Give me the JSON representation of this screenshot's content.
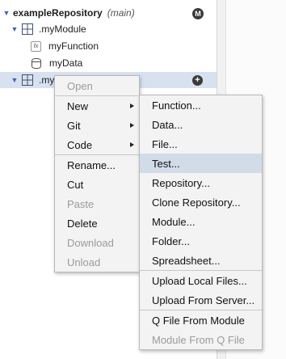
{
  "tree": {
    "repo": {
      "name": "exampleRepository",
      "branch": "(main)",
      "badge": "M"
    },
    "module": {
      "name": ".myModule"
    },
    "function_item": {
      "name": "myFunction",
      "icon": "function-icon"
    },
    "data_item": {
      "name": "myData",
      "icon": "database-icon"
    },
    "selected_module": {
      "name": ".my",
      "badge": "+"
    }
  },
  "context_menu": {
    "items": [
      {
        "label": "Open",
        "disabled": true
      },
      {
        "label": "New",
        "submenu": true
      },
      {
        "label": "Git",
        "submenu": true
      },
      {
        "label": "Code",
        "submenu": true
      },
      {
        "label": "Rename..."
      },
      {
        "label": "Cut"
      },
      {
        "label": "Paste",
        "disabled": true
      },
      {
        "label": "Delete"
      },
      {
        "label": "Download",
        "disabled": true
      },
      {
        "label": "Unload",
        "disabled": true
      }
    ]
  },
  "new_submenu": {
    "items": [
      {
        "label": "Function..."
      },
      {
        "label": "Data..."
      },
      {
        "label": "File..."
      },
      {
        "label": "Test...",
        "highlighted": true
      },
      {
        "label": "Repository..."
      },
      {
        "label": "Clone Repository..."
      },
      {
        "label": "Module..."
      },
      {
        "label": "Folder..."
      },
      {
        "label": "Spreadsheet..."
      },
      {
        "label": "Upload Local Files..."
      },
      {
        "label": "Upload From Server..."
      },
      {
        "label": "Q File From Module"
      },
      {
        "label": "Module From Q File",
        "disabled": true
      }
    ]
  },
  "colors": {
    "menu_bg": "#f3f3f3",
    "highlight": "#d2dbe8",
    "selected_row": "#d8e1f0",
    "caret": "#3d68b8"
  }
}
